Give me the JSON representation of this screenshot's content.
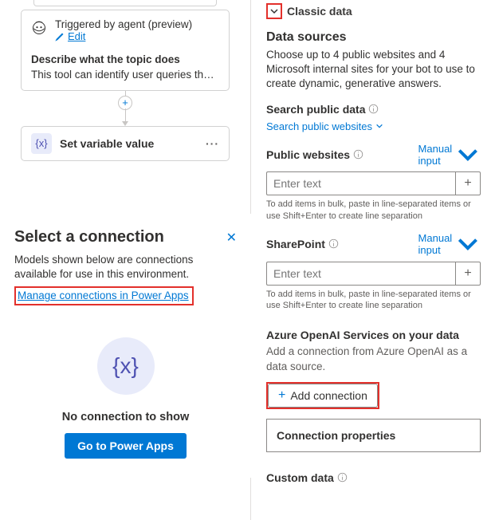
{
  "canvas": {
    "trigger_title": "Triggered by agent (preview)",
    "edit": "Edit",
    "describe_head": "Describe what the topic does",
    "describe_text": "This tool can identify user queries that seek f…",
    "set_var": "Set variable value",
    "var_symbol": "{x}"
  },
  "select": {
    "title": "Select a connection",
    "desc": "Models shown below are connections available for use in this environment.",
    "manage": "Manage connections in Power Apps",
    "none": "No connection to show",
    "cta": "Go to Power Apps"
  },
  "right": {
    "classic": "Classic data",
    "ds_head": "Data sources",
    "ds_desc": "Choose up to 4 public websites and 4 Microsoft internal sites for your bot to use to create dynamic, generative answers.",
    "search_label": "Search public data",
    "search_link": "Search public websites",
    "pub_label": "Public websites",
    "manual": "Manual input",
    "placeholder": "Enter text",
    "bulk_hint": "To add items in bulk, paste in line-separated items or use Shift+Enter to create line separation",
    "sp_label": "SharePoint",
    "aoai_head": "Azure OpenAI Services on your data",
    "aoai_desc": "Add a connection from Azure OpenAI as a data source.",
    "add_conn": "Add connection",
    "props": "Connection properties",
    "custom": "Custom data"
  }
}
